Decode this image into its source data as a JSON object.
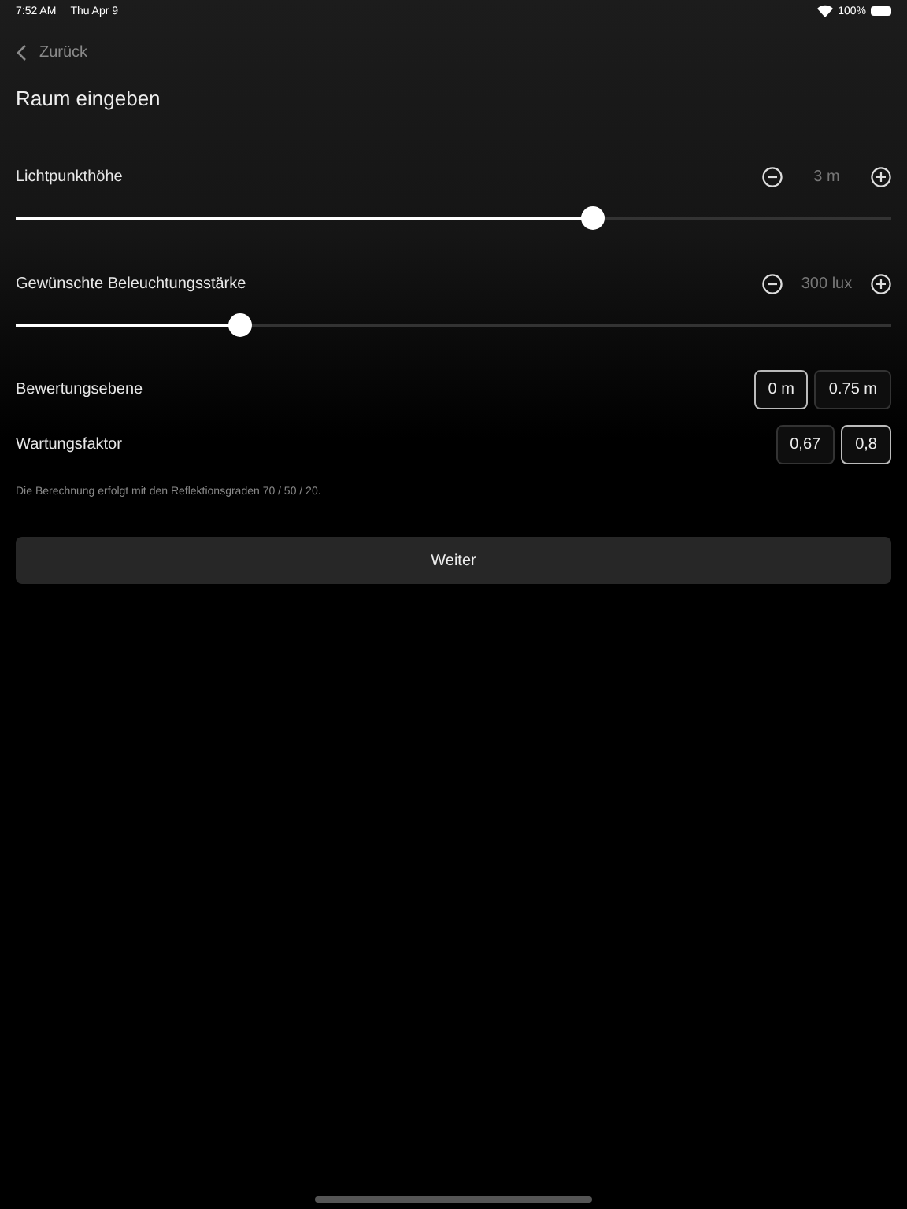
{
  "status_bar": {
    "time": "7:52 AM",
    "date": "Thu Apr 9",
    "battery": "100%"
  },
  "nav": {
    "back": "Zurück"
  },
  "title": "Raum eingeben",
  "sliders": [
    {
      "label": "Lichtpunkthöhe",
      "reading": "3 m",
      "level": 0.66
    },
    {
      "label": "Gewünschte Beleuchtungsstärke",
      "reading": "300 lux",
      "level": 0.257
    }
  ],
  "choices": [
    {
      "label": "Bewertungsebene",
      "options": [
        {
          "label": "0 m",
          "selected": true
        },
        {
          "label": "0.75 m",
          "selected": false
        }
      ]
    },
    {
      "label": "Wartungsfaktor",
      "options": [
        {
          "label": "0,67",
          "selected": false
        },
        {
          "label": "0,8",
          "selected": true
        }
      ]
    }
  ],
  "note": "Die Berechnung erfolgt mit den Reflektionsgraden 70 / 50 / 20.",
  "button": "Weiter"
}
